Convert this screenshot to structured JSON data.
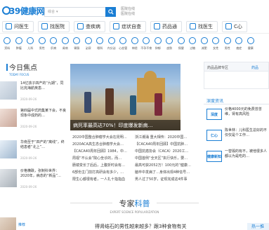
{
  "header": {
    "logo_text": "39健康网",
    "search": {
      "category": "综合",
      "placeholder": ""
    },
    "links": [
      "医院在线",
      "医院在线"
    ]
  },
  "nav": [
    {
      "label": "问医生",
      "icon": "doctor-icon"
    },
    {
      "label": "找医院",
      "icon": "hospital-icon"
    },
    {
      "label": "查疾病",
      "icon": "disease-icon"
    },
    {
      "label": "症状自查",
      "icon": "symptom-icon"
    },
    {
      "label": "药品通",
      "icon": "pill-icon"
    },
    {
      "label": "找医生",
      "icon": "find-doctor-icon"
    },
    {
      "label": "C心",
      "icon": "heart-icon"
    }
  ],
  "icon_row": [
    "资料",
    "肿瘤",
    "儿科",
    "男性",
    "肝病",
    "肾病",
    "胃肠",
    "泌尿",
    "眼科",
    "内分泌",
    "心血管",
    "神经",
    "不孕不育",
    "抑郁",
    "皮肤",
    "保健",
    "过敏",
    "减肥",
    "女性",
    "男性",
    "癌症",
    "健康"
  ],
  "focus": {
    "title": "今日焦点",
    "subtitle": "TODAY FOCUS",
    "items": [
      {
        "title": "14亿孩子四产的“九期”，同比完海航疾患…",
        "date": "2020-09-26"
      },
      {
        "title": "第四届中式药集某下会，不良现象中成药的…",
        "date": "2020-09-26"
      },
      {
        "title": "华南至于“四产的“离线”，终结患者“北上”…",
        "date": "2020-09-26"
      },
      {
        "title": "价格横跌，张制科世界：2020年，病态的“新品”…",
        "date": "2020-09-26"
      }
    ]
  },
  "hero": {
    "caption": "病死率最高达70%！印度爆发新病…"
  },
  "mid_list": [
    [
      "2020中国整合肿瘤学大会在昆明…",
      "浙江潮涌 重大相传：2020中国…"
    ],
    [
      "2020ACA高生态合肿瘤学大会…",
      "【CACA40周年回顾】中国抗肿…"
    ],
    [
      "【CACA40周年回顾】1984，中…",
      "中国抗癌协会（CACA）2020工…"
    ],
    [
      "周视“不认会”院心坐诊的，而…",
      "中国首例“全天区”执行快乐，要…"
    ],
    [
      "肠镜变长了后后，上腹折时会有…",
      "最高可获2052万！100元的“健康…"
    ],
    [
      "6部份主门前打高研会有多少，…",
      "脑卒中发病了…身体出现4种信号…"
    ],
    [
      "限生心都很有者，一人扎十指指血",
      "男人过了50岁，证现完成这4件事"
    ]
  ],
  "right": {
    "tabs": [
      "药品品牌专区",
      "药品"
    ],
    "section_title": "深度资讯",
    "items": [
      {
        "logo": "深度",
        "text": "价格4000元的免费曾曾维，肾有高风险"
      },
      {
        "logo": "仁心",
        "text": "陈世林：儿科医生总好的不仅仅是个工作…"
      },
      {
        "logo": "健康新知",
        "text": "一替毁的有不，被他很多人都以为是吃的…"
      }
    ]
  },
  "science": {
    "title_a": "专家",
    "title_b": "科普",
    "subtitle": "EXPERT SCIENCE POPULARIZATION"
  },
  "bottom": {
    "left_tag": "推荐",
    "mid_text": "得肾结石的男性越来越多？跟3种食物有关",
    "right_text": "热一推"
  }
}
